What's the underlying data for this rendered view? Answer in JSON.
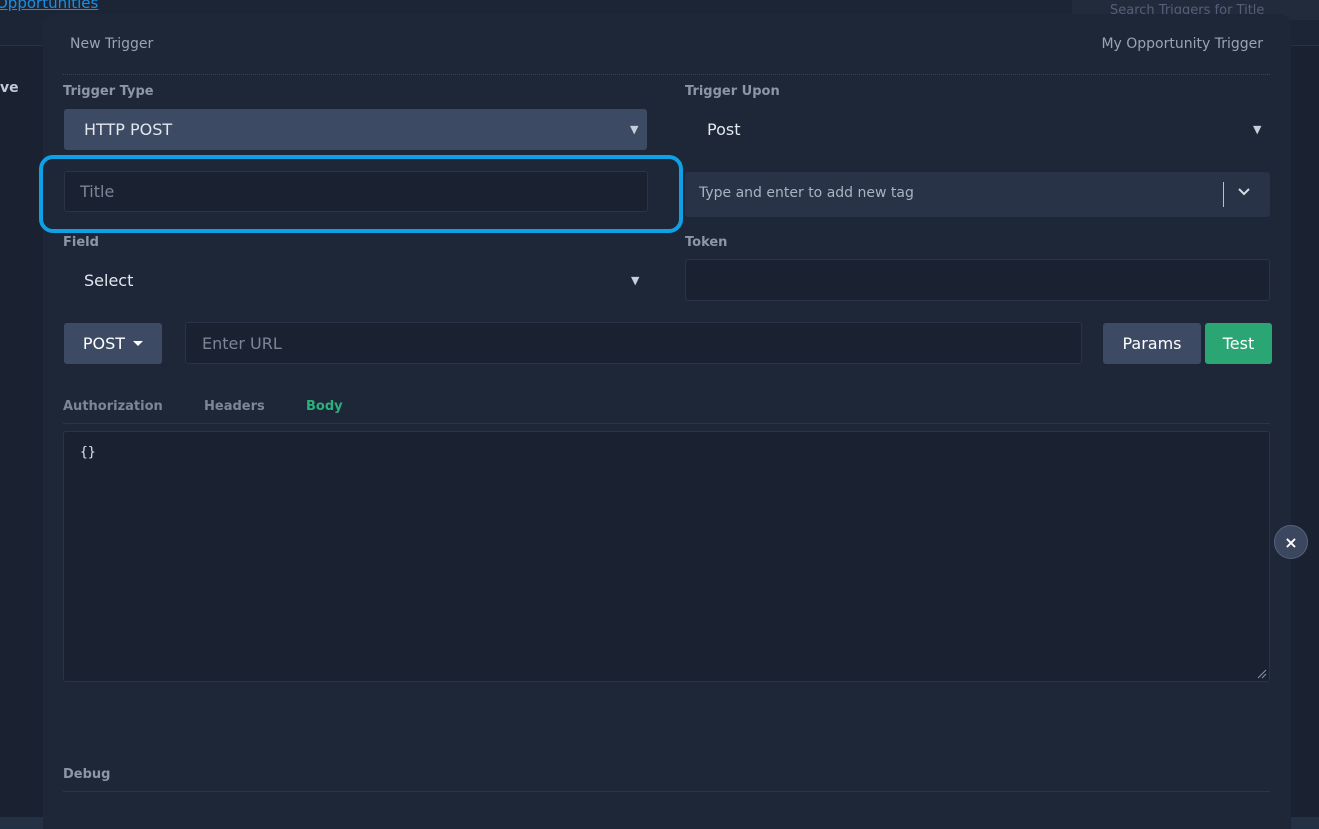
{
  "background": {
    "link_text": "Opportunities",
    "search_placeholder": "Search Triggers for Title",
    "side_text": "ve"
  },
  "modal": {
    "header_left": "New Trigger",
    "header_right": "My Opportunity Trigger",
    "trigger_type": {
      "label": "Trigger Type",
      "value": "HTTP POST"
    },
    "trigger_upon": {
      "label": "Trigger Upon",
      "value": "Post"
    },
    "title_input": {
      "placeholder": "Title",
      "value": ""
    },
    "tags": {
      "placeholder": "Type and enter to add new tag"
    },
    "field": {
      "label": "Field",
      "value": "Select"
    },
    "token": {
      "label": "Token",
      "value": ""
    },
    "request": {
      "method": "POST",
      "url_placeholder": "Enter URL",
      "params_label": "Params",
      "test_label": "Test"
    },
    "tabs": [
      {
        "label": "Authorization",
        "active": false
      },
      {
        "label": "Headers",
        "active": false
      },
      {
        "label": "Body",
        "active": true
      }
    ],
    "body_content": "{}",
    "debug_label": "Debug"
  },
  "colors": {
    "accent_green": "#2aa574",
    "highlight_blue": "#0ea1e6",
    "button_slate": "#3d4a63"
  },
  "close_glyph": "×"
}
